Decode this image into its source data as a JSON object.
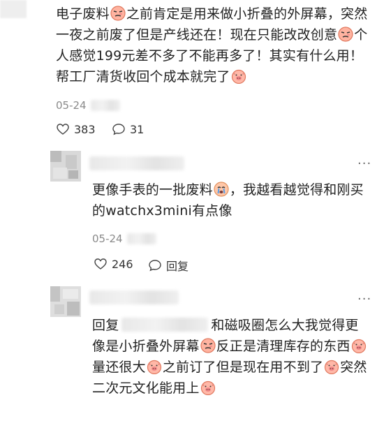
{
  "comments": [
    {
      "segments": [
        "电子废料",
        "之前肯定是用来做小折叠的外屏幕，突然一夜之前废了但是产线还在！现在只能改改创意",
        "个人感觉199元差不多了不能再多了！其实有什么用！帮工厂清货收回个成本就完了"
      ],
      "date": "05-24",
      "likes": "383",
      "comments": "31"
    },
    {
      "segments": [
        "更像手表的一批废料",
        "，我越看越觉得和刚买的watchx3mini有点像"
      ],
      "date": "05-24",
      "likes": "246",
      "reply_label": "回复"
    },
    {
      "reply_prefix": "回复",
      "segments": [
        "和磁吸圈怎么大我觉得更像是小折叠外屏幕",
        "反正是清理库存的东西",
        "量还很大",
        "之前订了但是现在用不到了",
        "突然二次元文化能用上"
      ]
    }
  ],
  "icons": {
    "like": "heart-outline-icon",
    "comment": "speech-bubble-icon",
    "more": "more-dots-icon",
    "emoji_smirk": "smirk-face-emoji",
    "emoji_cry": "crying-face-emoji",
    "emoji_pig": "pig-face-emoji"
  },
  "more_label": "···"
}
